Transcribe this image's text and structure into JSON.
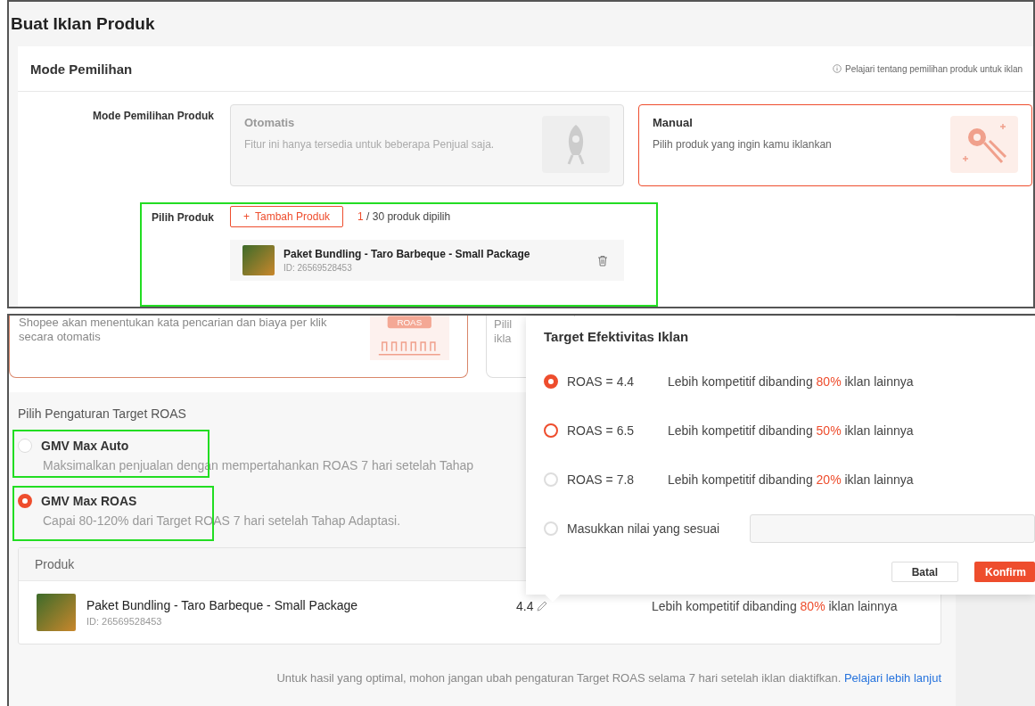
{
  "top_panel": {
    "title": "Buat Iklan Produk",
    "section_title": "Mode Pemilihan",
    "help_link": "Pelajari tentang pemilihan produk untuk iklan",
    "mode_label": "Mode Pemilihan Produk",
    "modes": [
      {
        "title": "Otomatis",
        "description": "Fitur ini hanya tersedia untuk beberapa Penjual saja.",
        "selected": false,
        "disabled": true,
        "kind": "rocket"
      },
      {
        "title": "Manual",
        "description": "Pilih produk yang ingin kamu iklankan",
        "selected": true,
        "disabled": false,
        "kind": "gear"
      }
    ],
    "product_label": "Pilih Produk",
    "add_button": "Tambah Produk",
    "add_icon": "+",
    "count_selected": "1",
    "count_rest": "/ 30 produk dipilih",
    "product": {
      "name": "Paket Bundling - Taro Barbeque - Small Package",
      "id": "ID: 26569528453"
    }
  },
  "bottom_panel": {
    "cards": [
      {
        "description": "Shopee akan menentukan kata pencarian dan biaya per klik secara otomatis",
        "badge": "ROAS",
        "selected": true
      },
      {
        "description_lines": [
          "Pilil",
          "ikla"
        ],
        "selected": false
      }
    ],
    "roas_label": "Pilih Pengaturan Target ROAS",
    "roas_options": [
      {
        "title": "GMV Max Auto",
        "description": "Maksimalkan penjualan dengan mempertahankan ROAS 7 hari setelah Tahap",
        "selected": false
      },
      {
        "title": "GMV Max ROAS",
        "description": "Capai 80-120% dari Target ROAS 7 hari setelah Tahap Adaptasi.",
        "selected": true
      }
    ],
    "table": {
      "header": "Produk",
      "rows": [
        {
          "name": "Paket Bundling - Taro Barbeque - Small Package",
          "id": "ID: 26569528453",
          "roas": "4.4",
          "comparison": {
            "before": "Lebih kompetitif dibanding",
            "percent": "80%",
            "after": "iklan lainnya"
          }
        }
      ]
    },
    "footer_note": "Untuk hasil yang optimal, mohon jangan ubah pengaturan Target ROAS selama 7 hari setelah iklan diaktifkan.",
    "footer_link": "Pelajari lebih lanjut"
  },
  "popup": {
    "title": "Target Efektivitas Iklan",
    "options": [
      {
        "kind": "preset",
        "label": "ROAS = 4.4",
        "selected": true,
        "color": "#ee4d2d",
        "comparison": {
          "before": "Lebih kompetitif dibanding",
          "percent": "80%",
          "after": "iklan lainnya"
        }
      },
      {
        "kind": "preset",
        "label": "ROAS = 6.5",
        "selected": false,
        "color": "#ee4d2d",
        "comparison": {
          "before": "Lebih kompetitif dibanding",
          "percent": "50%",
          "after": "iklan lainnya"
        }
      },
      {
        "kind": "preset",
        "label": "ROAS = 7.8",
        "selected": false,
        "color": "#dddddd",
        "comparison": {
          "before": "Lebih kompetitif dibanding",
          "percent": "20%",
          "after": "iklan lainnya"
        }
      },
      {
        "kind": "custom",
        "label": "Masukkan nilai yang sesuai",
        "selected": false,
        "color": "#dddddd"
      }
    ],
    "cancel_button": "Batal",
    "confirm_button": "Konfirm"
  }
}
